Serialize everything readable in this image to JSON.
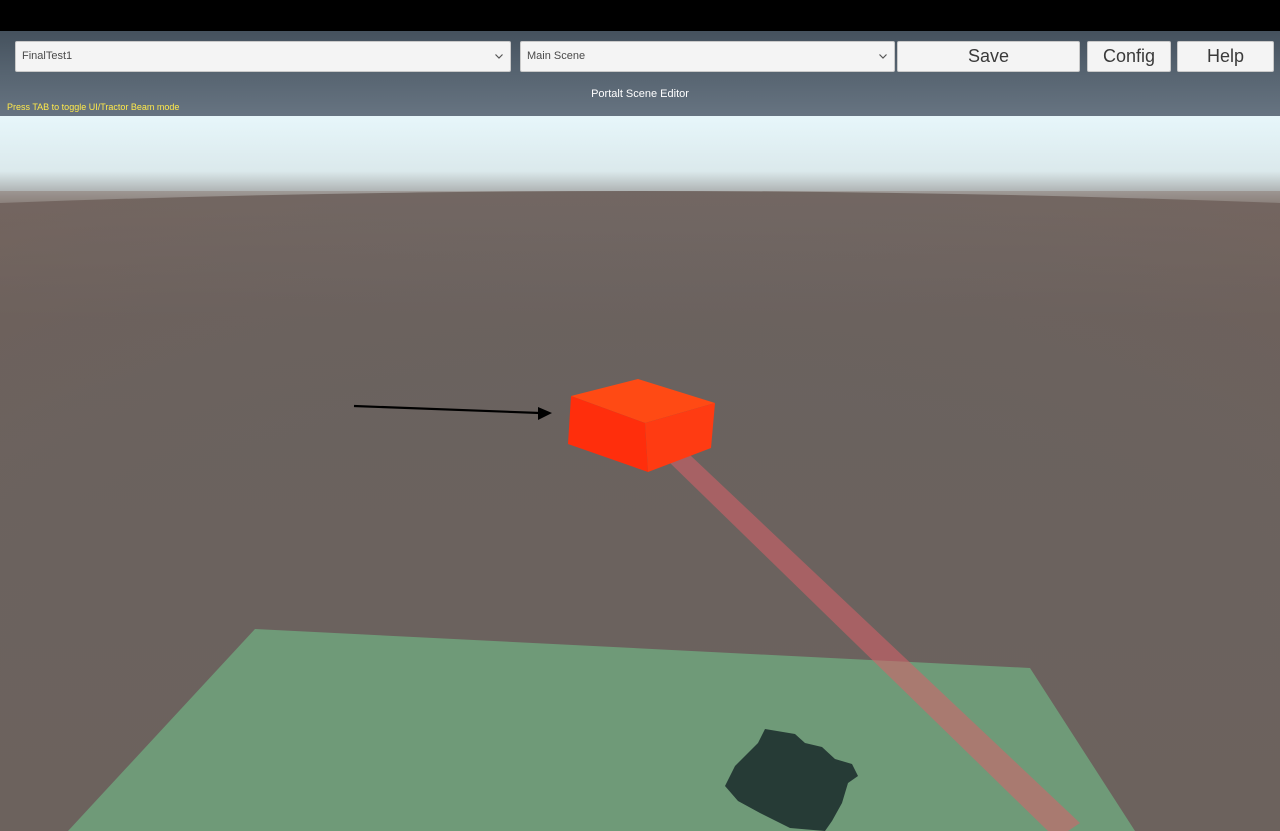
{
  "toolbar": {
    "project_select": {
      "value": "FinalTest1"
    },
    "scene_select": {
      "value": "Main Scene"
    },
    "save_label": "Save",
    "config_label": "Config",
    "help_label": "Help"
  },
  "editor": {
    "title": "Portalt Scene Editor",
    "hint": "Press TAB to toggle UI/Tractor Beam mode"
  },
  "scene": {
    "colors": {
      "sky": "#e6f7fb",
      "ground": "#6a615d",
      "platform": "#6f9a78",
      "cube": "#ff3a12",
      "beam": "#d8606a",
      "shadow": "#263b36",
      "arrow": "#000000"
    },
    "objects": [
      "arrow-icon",
      "red-cube",
      "tractor-beam",
      "green-platform",
      "dark-shadow"
    ]
  }
}
